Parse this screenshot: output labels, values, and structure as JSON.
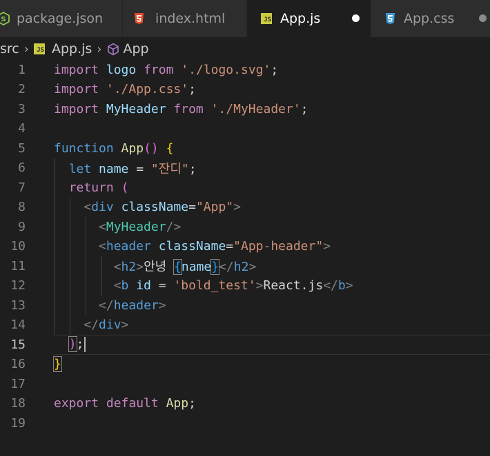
{
  "tabs": [
    {
      "label": "package.json",
      "icon": "nodejs-icon",
      "active": false
    },
    {
      "label": "index.html",
      "icon": "html5-icon",
      "active": false
    },
    {
      "label": "App.js",
      "icon": "js-icon",
      "icon_text": "JS",
      "active": true,
      "unsaved": true
    },
    {
      "label": "App.css",
      "icon": "css3-icon",
      "active": false,
      "unsaved": true
    }
  ],
  "breadcrumb": {
    "folder": "src",
    "file": "App.js",
    "file_icon_text": "JS",
    "symbol": "App"
  },
  "editor": {
    "current_line": 15,
    "line_numbers": [
      "1",
      "2",
      "3",
      "4",
      "5",
      "6",
      "7",
      "8",
      "9",
      "10",
      "11",
      "12",
      "13",
      "14",
      "15",
      "16",
      "17",
      "18",
      "19"
    ],
    "tokens": {
      "l1_import": "import",
      "l1_logo": "logo",
      "l1_from": "from",
      "l1_path": "'./logo.svg'",
      "l1_semi": ";",
      "l2_import": "import",
      "l2_path": "'./App.css'",
      "l2_semi": ";",
      "l3_import": "import",
      "l3_name": "MyHeader",
      "l3_from": "from",
      "l3_path": "'./MyHeader'",
      "l3_semi": ";",
      "l5_function": "function",
      "l5_name": "App",
      "l5_paren": "()",
      "l5_brace": "{",
      "l6_let": "let",
      "l6_var": "name",
      "l6_eq": " = ",
      "l6_str": "\"잔디\"",
      "l6_semi": ";",
      "l7_return": "return",
      "l7_paren": "(",
      "l8_open": "<",
      "l8_tag": "div",
      "l8_attr": "className",
      "l8_eq": "=",
      "l8_val": "\"App\"",
      "l8_close": ">",
      "l9_open": "<",
      "l9_comp": "MyHeader",
      "l9_close": "/>",
      "l10_open": "<",
      "l10_tag": "header",
      "l10_attr": "className",
      "l10_eq": "=",
      "l10_val": "\"App-header\"",
      "l10_close": ">",
      "l11_open": "<",
      "l11_tag": "h2",
      "l11_gt": ">",
      "l11_text": "안녕 ",
      "l11_lbrace": "{",
      "l11_var": "name",
      "l11_rbrace": "}",
      "l11_endopen": "</",
      "l11_endtag": "h2",
      "l11_endclose": ">",
      "l12_open": "<",
      "l12_tag": "b",
      "l12_attr": "id",
      "l12_eq": " = ",
      "l12_val": "'bold_test'",
      "l12_gt": ">",
      "l12_text": "React.js",
      "l12_endopen": "</",
      "l12_endtag": "b",
      "l12_endclose": ">",
      "l13_open": "</",
      "l13_tag": "header",
      "l13_close": ">",
      "l14_open": "</",
      "l14_tag": "div",
      "l14_close": ">",
      "l15_paren": ")",
      "l15_semi": ";",
      "l16_brace": "}",
      "l18_export": "export",
      "l18_default": "default",
      "l18_name": "App",
      "l18_semi": ";"
    }
  },
  "colors": {
    "background": "#1e1e1e",
    "tabbar": "#252526",
    "keyword": "#c586c0",
    "storage": "#569cd6",
    "string": "#ce9178",
    "function": "#dcdcaa",
    "component": "#4ec9b0",
    "variable": "#9cdcfe"
  }
}
